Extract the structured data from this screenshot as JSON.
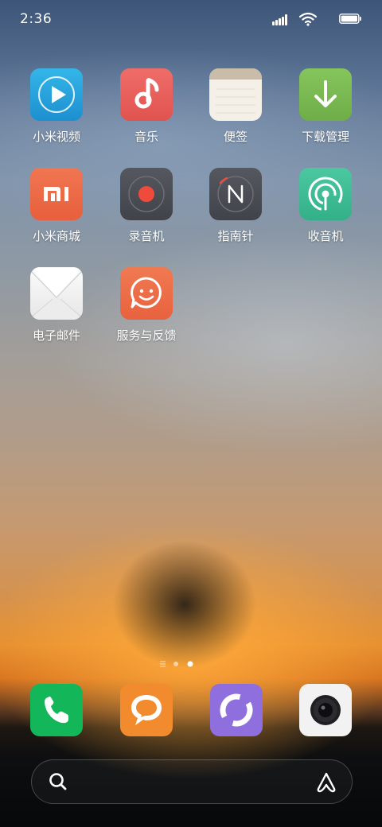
{
  "status_bar": {
    "time": "2:36",
    "icons": [
      "signal-icon",
      "wifi-icon",
      "battery-icon"
    ]
  },
  "apps": [
    {
      "label": "小米视频",
      "icon": "video-play-icon",
      "color": "#2aa3dd"
    },
    {
      "label": "音乐",
      "icon": "music-note-icon",
      "color": "#e8625f"
    },
    {
      "label": "便签",
      "icon": "notes-icon",
      "color": "#f3efe6"
    },
    {
      "label": "下载管理",
      "icon": "download-arrow-icon",
      "color": "#7db854"
    },
    {
      "label": "小米商城",
      "icon": "mi-logo-icon",
      "color": "#ee6a45"
    },
    {
      "label": "录音机",
      "icon": "record-icon",
      "color": "#4a4d54"
    },
    {
      "label": "指南针",
      "icon": "compass-icon",
      "color": "#4a4d54"
    },
    {
      "label": "收音机",
      "icon": "radio-signal-icon",
      "color": "#3fbb95"
    },
    {
      "label": "电子邮件",
      "icon": "envelope-icon",
      "color": "#f2f2f2"
    },
    {
      "label": "服务与反馈",
      "icon": "smile-chat-icon",
      "color": "#ee6f48"
    }
  ],
  "pager": {
    "pages": 3,
    "current": 3
  },
  "dock": [
    {
      "icon": "phone-icon",
      "color": "#13b55a"
    },
    {
      "icon": "message-icon",
      "color": "#f08a30"
    },
    {
      "icon": "browser-icon",
      "color": "#8d6fdc"
    },
    {
      "icon": "camera-icon",
      "color": "#f0f0f0"
    }
  ],
  "search": {
    "placeholder": "",
    "icon": "search-icon",
    "assistant_icon": "assistant-icon"
  }
}
